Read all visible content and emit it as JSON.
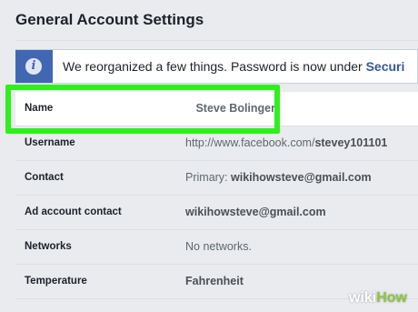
{
  "page": {
    "title": "General Account Settings"
  },
  "banner": {
    "icon": "info-icon",
    "message": "We reorganized a few things. Password is now under ",
    "link": "Securi"
  },
  "settings": [
    {
      "label": "Name",
      "value": "Steve Bolinger"
    },
    {
      "label": "Username",
      "value_prefix": "http://www.facebook.com/",
      "value_bold": "stevey101101"
    },
    {
      "label": "Contact",
      "value_prefix": "Primary: ",
      "value_bold": "wikihowsteve@gmail.com"
    },
    {
      "label": "Ad account contact",
      "value": "wikihowsteve@gmail.com"
    },
    {
      "label": "Networks",
      "value": "No networks."
    },
    {
      "label": "Temperature",
      "value": "Fahrenheit"
    }
  ],
  "watermark": {
    "part1": "wiki",
    "part2": "How"
  },
  "colors": {
    "accent": "#4267b2",
    "highlight": "#2ef01c",
    "background": "#e9ebee"
  }
}
